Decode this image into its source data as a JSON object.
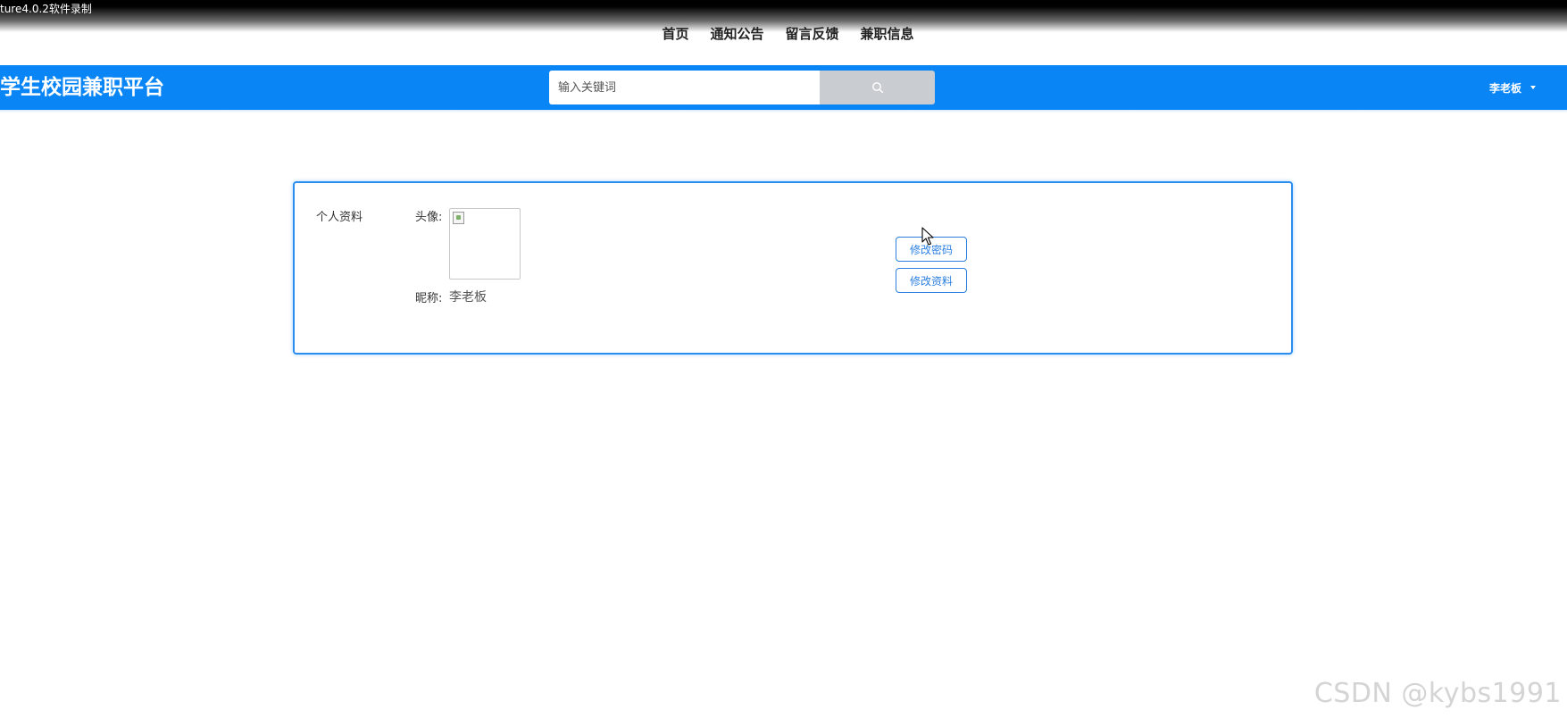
{
  "recorder": {
    "caption": "ture4.0.2软件录制"
  },
  "top_nav": {
    "items": [
      {
        "label": "首页"
      },
      {
        "label": "通知公告"
      },
      {
        "label": "留言反馈"
      },
      {
        "label": "兼职信息"
      }
    ]
  },
  "header": {
    "site_title": "学生校园兼职平台",
    "search": {
      "placeholder": "输入关键词",
      "value": ""
    },
    "user": {
      "name": "李老板"
    }
  },
  "profile": {
    "section_title": "个人资料",
    "avatar_label": "头像:",
    "nickname_label": "昵称:",
    "nickname_value": "李老板",
    "change_password_label": "修改密码",
    "edit_profile_label": "修改资料"
  },
  "watermark": "CSDN @kybs1991",
  "colors": {
    "header_bg": "#0a85f5",
    "search_button": "#c9cdd2",
    "card_border": "#2a8ef0",
    "button_outline": "#2a7fe0"
  },
  "icons": {
    "search_button": "search-icon",
    "user_menu": "caret-down-icon",
    "avatar": "broken-image-icon"
  }
}
